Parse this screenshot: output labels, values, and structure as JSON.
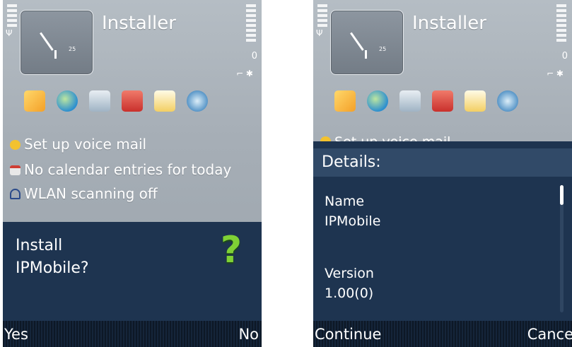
{
  "left_screen": {
    "title": "Installer",
    "clock_date": "25",
    "battery_level": "0",
    "notifications": [
      "Set up voice mail",
      "No calendar entries for today",
      "WLAN scanning off"
    ],
    "dialog": {
      "line1": "Install",
      "line2": "IPMobile?"
    },
    "softkeys": {
      "left": "Yes",
      "right": "No"
    }
  },
  "right_screen": {
    "title": "Installer",
    "clock_date": "25",
    "battery_level": "0",
    "peek_notification": "Set up voice mail",
    "details": {
      "header": "Details:",
      "name_label": "Name",
      "name_value": "IPMobile",
      "version_label": "Version",
      "version_value": "1.00(0)"
    },
    "softkeys": {
      "left": "Continue",
      "right": "Cance"
    }
  },
  "icons": [
    "signal-icon",
    "battery-icon",
    "antenna-icon",
    "bluetooth-icon",
    "messaging-icon",
    "web-icon",
    "connectivity-icon",
    "notes-icon",
    "calendar-icon",
    "tools-icon",
    "voicemail-icon",
    "calendar-entry-icon",
    "wlan-icon",
    "question-icon"
  ],
  "colors": {
    "dialog_bg": "#1e3450",
    "softbar_bg": "#0d1826",
    "question_green": "#7fd135"
  }
}
